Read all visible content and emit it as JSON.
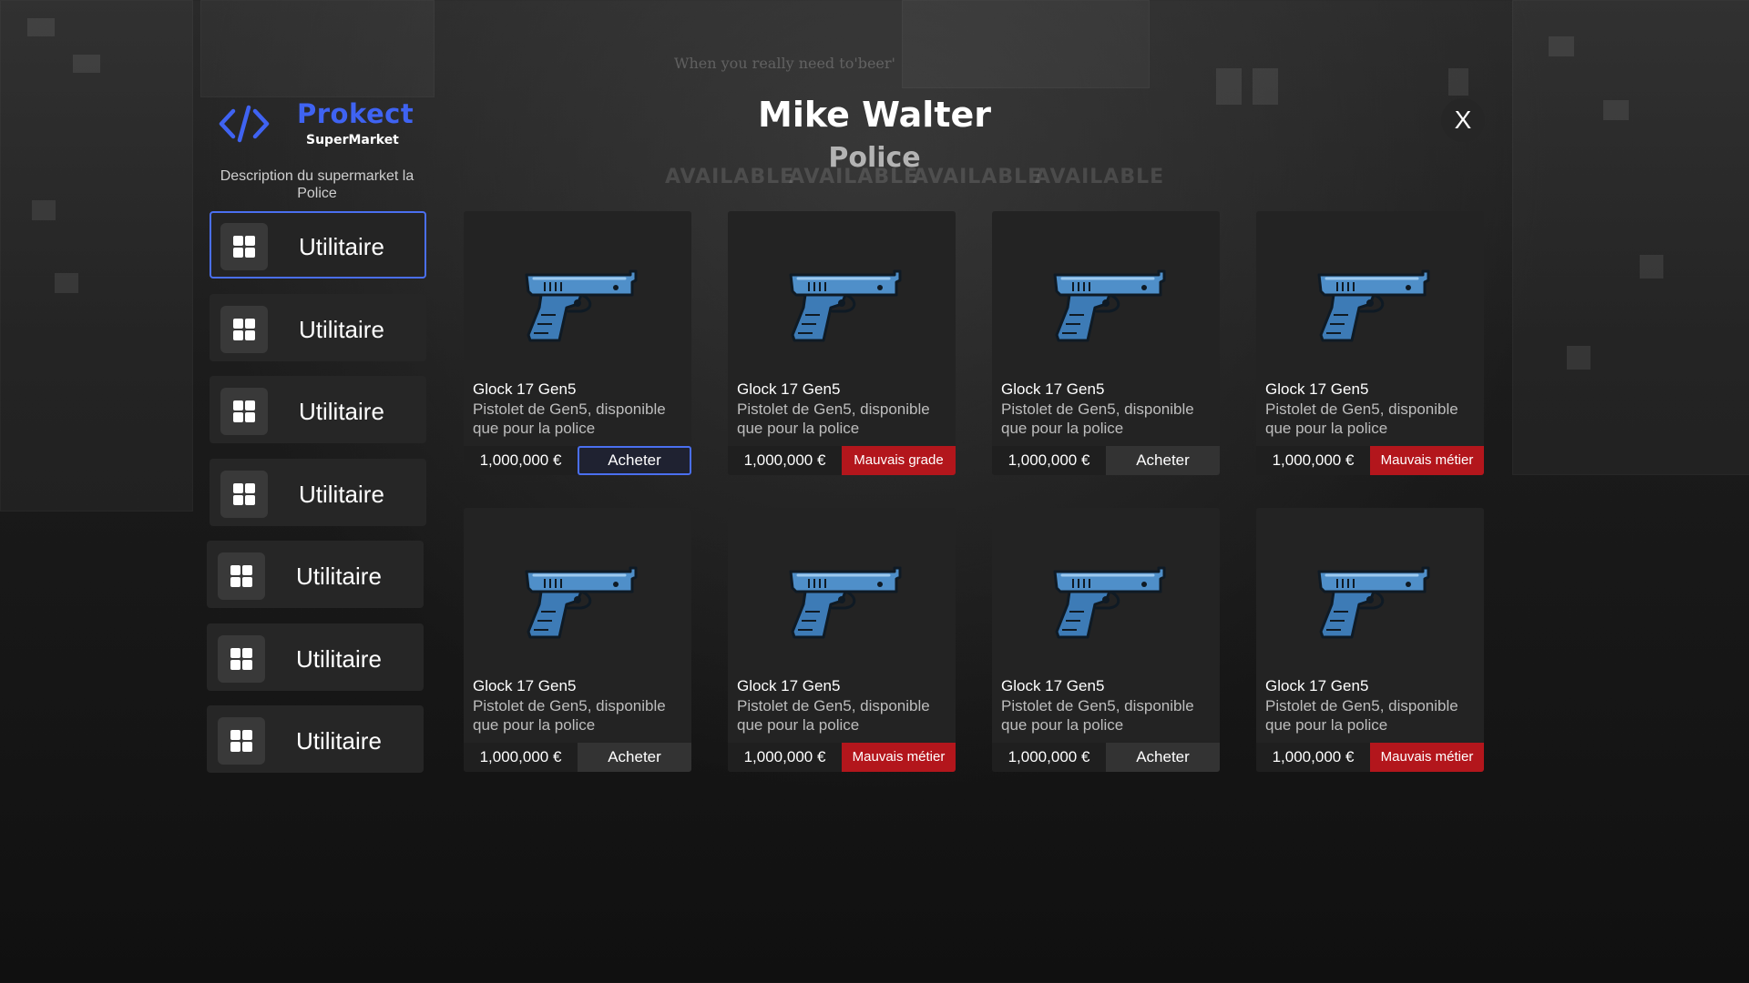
{
  "backdrop": {
    "tagline": "When you really need to'beer'",
    "signs": [
      "AVAILABLE",
      "AVAILABLE",
      "AVAILABLE",
      "AVAILABLE"
    ]
  },
  "brand": {
    "name": "Prokect",
    "subtitle": "SuperMarket",
    "color": "#3f63f2"
  },
  "description": "Description du supermarket la Police",
  "header": {
    "name": "Mike Walter",
    "job": "Police",
    "close_label": "X"
  },
  "sidebar": {
    "accent": "#4a6ff0",
    "items": [
      {
        "label": "Utilitaire",
        "icon": "grid-icon",
        "active": true
      },
      {
        "label": "Utilitaire",
        "icon": "grid-icon",
        "active": false
      },
      {
        "label": "Utilitaire",
        "icon": "grid-icon",
        "active": false
      },
      {
        "label": "Utilitaire",
        "icon": "grid-icon",
        "active": false
      },
      {
        "label": "Utilitaire",
        "icon": "grid-icon",
        "active": false
      },
      {
        "label": "Utilitaire",
        "icon": "grid-icon",
        "active": false
      },
      {
        "label": "Utilitaire",
        "icon": "grid-icon",
        "active": false
      }
    ]
  },
  "products": [
    {
      "title": "Glock 17 Gen5",
      "description": "Pistolet de Gen5, disponible que pour la police",
      "price": "1,000,000 €",
      "action": "Acheter",
      "status": "buy",
      "focused": true,
      "icon": "pistol-icon"
    },
    {
      "title": "Glock 17 Gen5",
      "description": "Pistolet de Gen5, disponible que pour la police",
      "price": "1,000,000 €",
      "action": "Mauvais grade",
      "status": "error",
      "focused": false,
      "icon": "pistol-icon"
    },
    {
      "title": "Glock 17 Gen5",
      "description": "Pistolet de Gen5, disponible que pour la police",
      "price": "1,000,000 €",
      "action": "Acheter",
      "status": "buy",
      "focused": false,
      "icon": "pistol-icon"
    },
    {
      "title": "Glock 17 Gen5",
      "description": "Pistolet de Gen5, disponible que pour la police",
      "price": "1,000,000 €",
      "action": "Mauvais métier",
      "status": "error",
      "focused": false,
      "icon": "pistol-icon"
    },
    {
      "title": "Glock 17 Gen5",
      "description": "Pistolet de Gen5, disponible que pour la police",
      "price": "1,000,000 €",
      "action": "Acheter",
      "status": "buy",
      "focused": false,
      "icon": "pistol-icon"
    },
    {
      "title": "Glock 17 Gen5",
      "description": "Pistolet de Gen5, disponible que pour la police",
      "price": "1,000,000 €",
      "action": "Mauvais métier",
      "status": "error",
      "focused": false,
      "icon": "pistol-icon"
    },
    {
      "title": "Glock 17 Gen5",
      "description": "Pistolet de Gen5, disponible que pour la police",
      "price": "1,000,000 €",
      "action": "Acheter",
      "status": "buy",
      "focused": false,
      "icon": "pistol-icon"
    },
    {
      "title": "Glock 17 Gen5",
      "description": "Pistolet de Gen5, disponible que pour la police",
      "price": "1,000,000 €",
      "action": "Mauvais métier",
      "status": "error",
      "focused": false,
      "icon": "pistol-icon"
    }
  ],
  "colors": {
    "error": "#b3161c",
    "button": "#333333",
    "card": "#232323"
  }
}
